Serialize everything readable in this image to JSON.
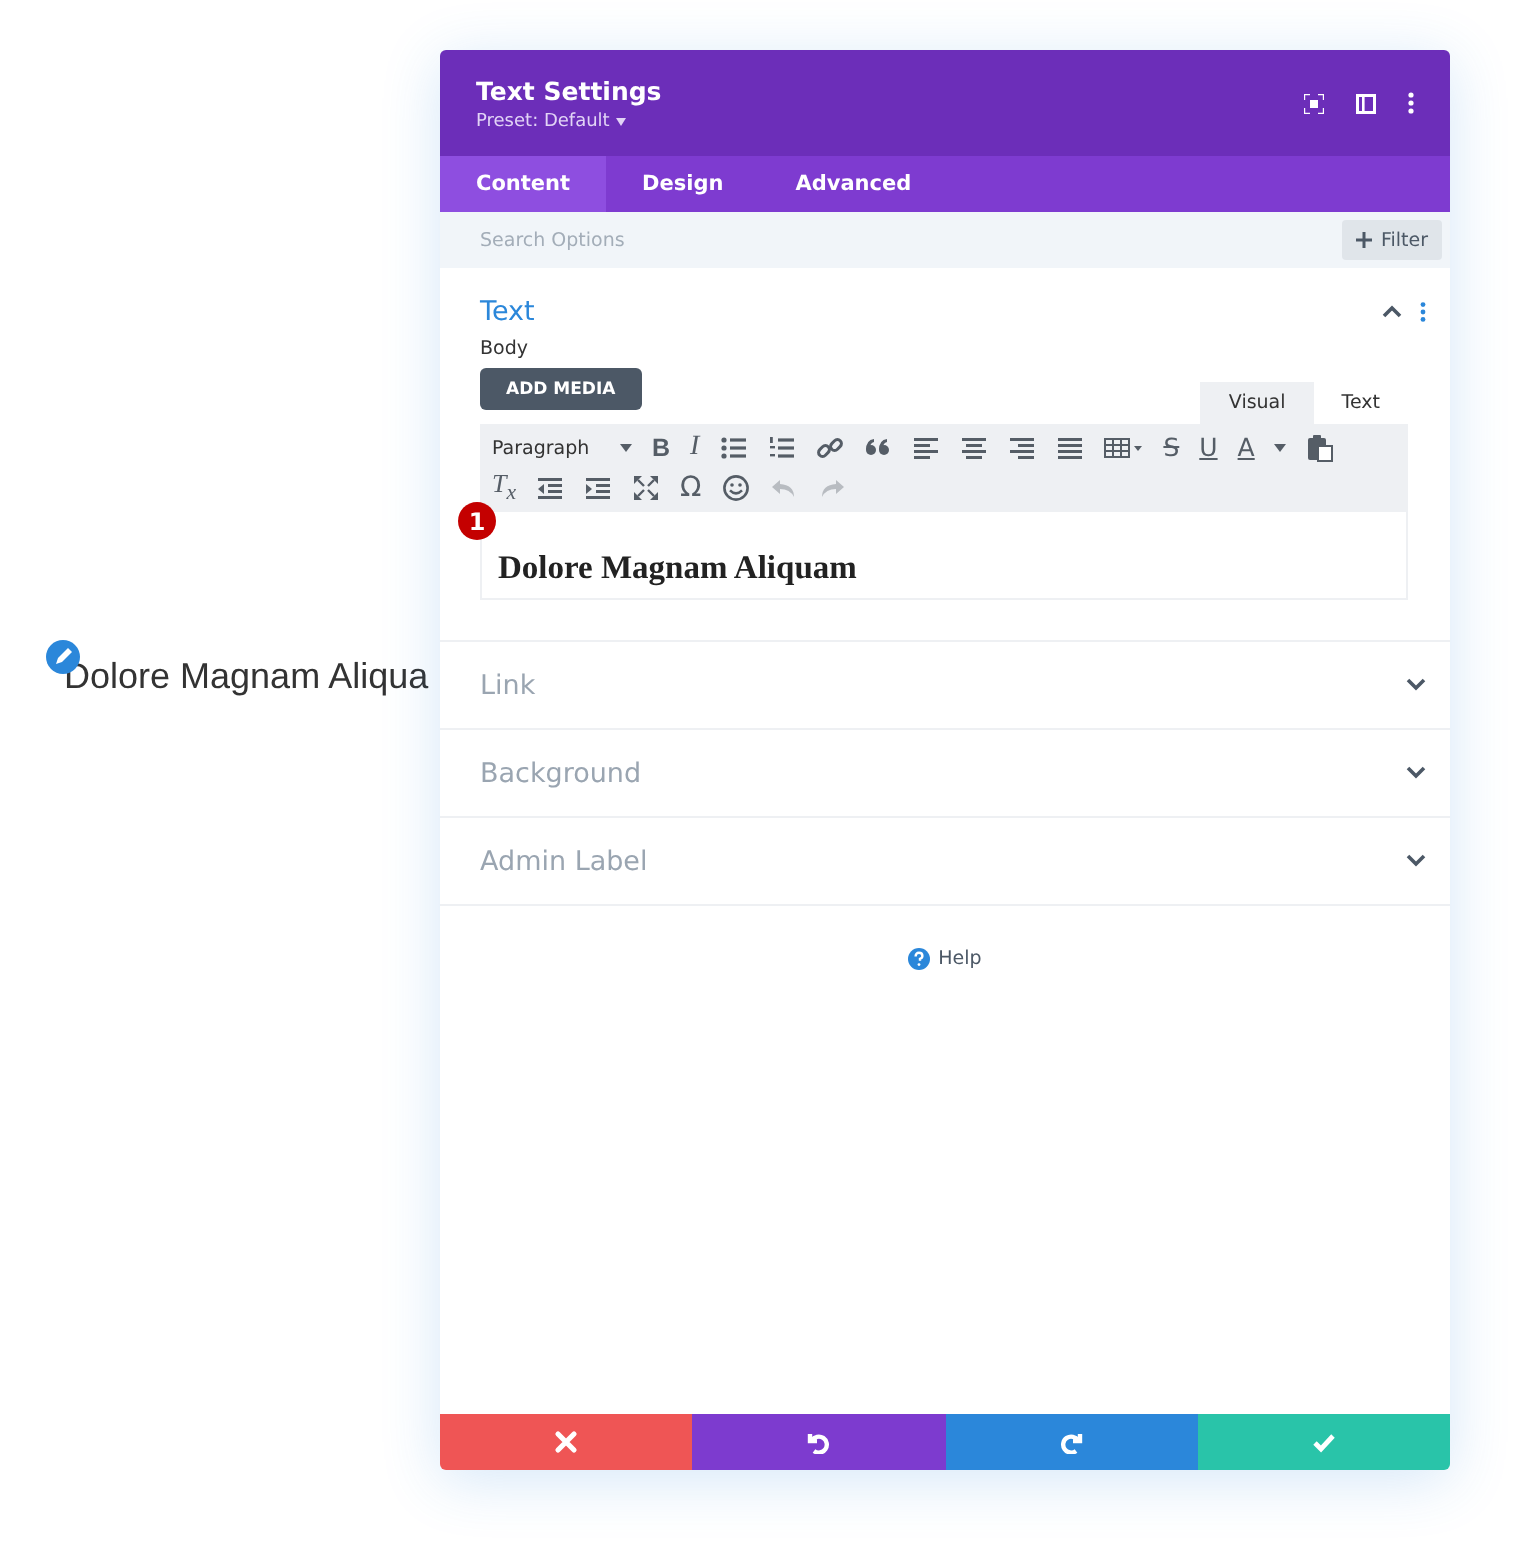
{
  "page_text": "Dolore Magnam Aliqua",
  "modal": {
    "title": "Text Settings",
    "preset": "Preset: Default",
    "tabs": [
      {
        "label": "Content",
        "selected": true
      },
      {
        "label": "Design",
        "selected": false
      },
      {
        "label": "Advanced",
        "selected": false
      }
    ],
    "search": {
      "placeholder": "Search Options"
    },
    "filter": "Filter",
    "sections": [
      {
        "title": "Text",
        "expanded": true
      },
      {
        "title": "Link",
        "expanded": false
      },
      {
        "title": "Background",
        "expanded": false
      },
      {
        "title": "Admin Label",
        "expanded": false
      }
    ],
    "body_label": "Body",
    "add_media": "ADD MEDIA",
    "editor_tabs": [
      {
        "label": "Visual",
        "selected": true
      },
      {
        "label": "Text",
        "selected": false
      }
    ],
    "toolbar": [
      [
        {
          "kind": "select",
          "label": "Paragraph",
          "disabled": false
        },
        {
          "kind": "bold",
          "label": "B",
          "disabled": false
        },
        {
          "kind": "italic",
          "label": "I",
          "disabled": false
        },
        {
          "kind": "icon",
          "disabled": false
        },
        {
          "kind": "icon",
          "disabled": false
        },
        {
          "kind": "icon",
          "disabled": false
        },
        {
          "kind": "icon",
          "disabled": false
        },
        {
          "kind": "icon",
          "disabled": false
        },
        {
          "kind": "icon",
          "disabled": false
        },
        {
          "kind": "icon",
          "disabled": false
        },
        {
          "kind": "icon",
          "disabled": false
        },
        {
          "kind": "icon",
          "disabled": false
        },
        {
          "kind": "strike",
          "label": "S",
          "disabled": false
        },
        {
          "kind": "underline",
          "label": "U",
          "disabled": false
        },
        {
          "kind": "color",
          "label": "A",
          "disabled": false
        },
        {
          "kind": "icon",
          "disabled": false
        }
      ],
      [
        {
          "kind": "clear",
          "label": "T$_{x}$",
          "disabled": false
        },
        {
          "kind": "icon",
          "disabled": false
        },
        {
          "kind": "icon",
          "disabled": false
        },
        {
          "kind": "icon",
          "disabled": false
        },
        {
          "kind": "plain",
          "label": "Ω",
          "disabled": false
        },
        {
          "kind": "icon",
          "disabled": false
        },
        {
          "kind": "icon",
          "disabled": true
        },
        {
          "kind": "icon",
          "disabled": true
        }
      ]
    ],
    "badge": "1",
    "editor_content": "Dolore Magnam Aliquam",
    "help": "Help",
    "footer": [
      {
        "color": "#ef5555"
      },
      {
        "color": "#7d3bcf"
      },
      {
        "color": "#2b87da"
      },
      {
        "color": "#29c4a9"
      }
    ]
  }
}
